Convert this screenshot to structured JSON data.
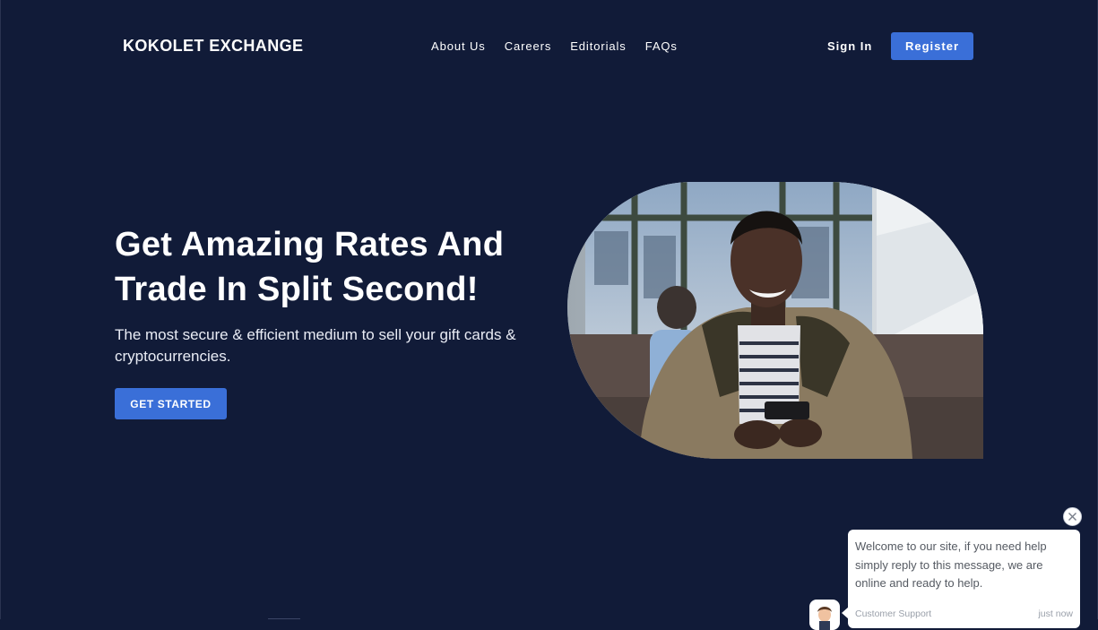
{
  "header": {
    "logo": "KOKOLET EXCHANGE",
    "nav": [
      "About Us",
      "Careers",
      "Editorials",
      "FAQs"
    ],
    "signin_label": "Sign In",
    "register_label": "Register"
  },
  "hero": {
    "title": "Get Amazing Rates And Trade In Split Second!",
    "subtitle": "The most secure & efficient medium to sell your gift cards & cryptocurrencies.",
    "cta_label": "GET STARTED"
  },
  "chat": {
    "message": "Welcome to our site, if you need help simply reply to this message, we are online and ready to help.",
    "sender": "Customer Support",
    "time": "just now",
    "close_icon": "close-icon",
    "avatar_icon": "support-agent-avatar"
  },
  "colors": {
    "background": "#111b38",
    "accent": "#3a6fd8",
    "text": "#ffffff"
  }
}
